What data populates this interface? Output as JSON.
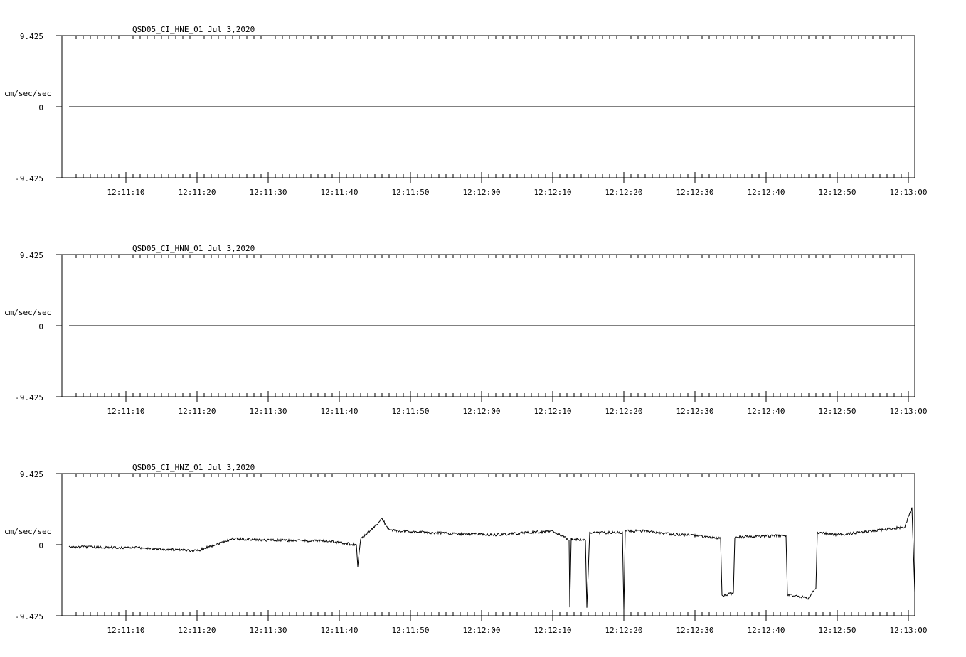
{
  "chart_data": [
    {
      "type": "line",
      "title": "QSD05_CI_HNE_01  Jul 3,2020",
      "ylabel": "cm/sec/sec",
      "ylim": [
        -9.425,
        9.425
      ],
      "ytick_labels": [
        "9.425",
        "0",
        "-9.425"
      ],
      "x_tick_labels": [
        "12:11:10",
        "12:11:20",
        "12:11:30",
        "12:11:40",
        "12:11:50",
        "12:12:00",
        "12:12:10",
        "12:12:20",
        "12:12:30",
        "12:12:40",
        "12:12:50",
        "12:13:00"
      ],
      "x_start": "12:11:02.3",
      "x_end": "12:13:00.9",
      "series": [
        {
          "x": [
            "12:11:02",
            "12:13:01"
          ],
          "values": [
            0,
            0
          ]
        }
      ]
    },
    {
      "type": "line",
      "title": "QSD05_CI_HNN_01  Jul 3,2020",
      "ylabel": "cm/sec/sec",
      "ylim": [
        -9.425,
        9.425
      ],
      "ytick_labels": [
        "9.425",
        "0",
        "-9.425"
      ],
      "x_tick_labels": [
        "12:11:10",
        "12:11:20",
        "12:11:30",
        "12:11:40",
        "12:11:50",
        "12:12:00",
        "12:12:10",
        "12:12:20",
        "12:12:30",
        "12:12:40",
        "12:12:50",
        "12:13:00"
      ],
      "x_start": "12:11:02.3",
      "x_end": "12:13:00.9",
      "series": [
        {
          "x": [
            "12:11:02",
            "12:13:01"
          ],
          "values": [
            0,
            0
          ]
        }
      ]
    },
    {
      "type": "line",
      "title": "QSD05_CI_HNZ_01  Jul 3,2020",
      "ylabel": "cm/sec/sec",
      "ylim": [
        -9.425,
        9.425
      ],
      "ytick_labels": [
        "9.425",
        "0",
        "-9.425"
      ],
      "x_tick_labels": [
        "12:11:10",
        "12:11:20",
        "12:11:30",
        "12:11:40",
        "12:11:50",
        "12:12:00",
        "12:12:10",
        "12:12:20",
        "12:12:30",
        "12:12:40",
        "12:12:50",
        "12:13:00"
      ],
      "x_start": "12:11:02.3",
      "x_end": "12:13:00.9",
      "series": [
        {
          "x": [
            "12:11:02",
            "12:11:12",
            "12:11:15",
            "12:11:20",
            "12:11:25",
            "12:11:30",
            "12:11:38",
            "12:11:42.4",
            "12:11:42.6",
            "12:11:43",
            "12:11:45",
            "12:11:46",
            "12:11:47",
            "12:11:48",
            "12:11:55",
            "12:12:02",
            "12:12:10",
            "12:12:12.3",
            "12:12:12.4",
            "12:12:12.6",
            "12:12:14.6",
            "12:12:14.8",
            "12:12:15.2",
            "12:12:19.8",
            "12:12:20.0",
            "12:12:20.2",
            "12:12:23",
            "12:12:25",
            "12:12:30",
            "12:12:33.6",
            "12:12:33.8",
            "12:12:35.4",
            "12:12:35.6",
            "12:12:42.8",
            "12:12:43.0",
            "12:12:46.0",
            "12:12:47.0",
            "12:12:47.2",
            "12:12:50",
            "12:12:55",
            "12:12:59",
            "12:12:59.4",
            "12:13:00.3",
            "12:13:00.5",
            "12:13:00.9"
          ],
          "values": [
            -0.3,
            -0.4,
            -0.6,
            -0.8,
            0.8,
            0.6,
            0.5,
            0.0,
            -3.0,
            0.8,
            2.4,
            3.4,
            2.0,
            1.8,
            1.5,
            1.3,
            1.8,
            0.6,
            -8.3,
            0.8,
            0.6,
            -8.5,
            1.6,
            1.6,
            -8.7,
            1.8,
            1.8,
            1.5,
            1.2,
            0.8,
            -6.8,
            -6.4,
            1.0,
            1.2,
            -6.6,
            -7.1,
            -5.8,
            1.6,
            1.3,
            1.8,
            2.3,
            2.2,
            4.4,
            4.8,
            -6.3
          ]
        }
      ]
    }
  ]
}
